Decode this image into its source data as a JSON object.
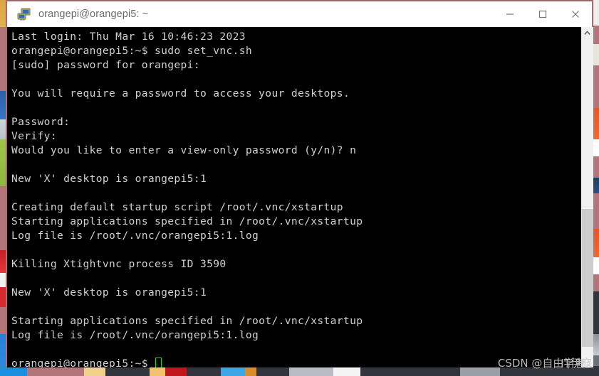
{
  "window": {
    "title": "orangepi@orangepi5: ~",
    "icon": "remote-desktop-icon",
    "controls": [
      {
        "name": "minimize-button",
        "label": "—",
        "glyph": "minimize"
      },
      {
        "name": "maximize-button",
        "label": "☐",
        "glyph": "maximize"
      },
      {
        "name": "close-button",
        "label": "✕",
        "glyph": "close"
      }
    ]
  },
  "terminal": {
    "foreground": "#cfcfcf",
    "background": "#000000",
    "cursor_color": "#21d421",
    "lines": [
      "Last login: Thu Mar 16 10:46:23 2023",
      "orangepi@orangepi5:~$ sudo set_vnc.sh",
      "[sudo] password for orangepi:",
      "",
      "You will require a password to access your desktops.",
      "",
      "Password:",
      "Verify:",
      "Would you like to enter a view-only password (y/n)? n",
      "",
      "New 'X' desktop is orangepi5:1",
      "",
      "Creating default startup script /root/.vnc/xstartup",
      "Starting applications specified in /root/.vnc/xstartup",
      "Log file is /root/.vnc/orangepi5:1.log",
      "",
      "Killing Xtightvnc process ID 3590",
      "",
      "New 'X' desktop is orangepi5:1",
      "",
      "Starting applications specified in /root/.vnc/xstartup",
      "Log file is /root/.vnc/orangepi5:1.log",
      ""
    ],
    "prompt": "orangepi@orangepi5:~$ "
  },
  "scrollbar": {
    "up_arrow": "▲",
    "name": "terminal-scrollbar"
  },
  "watermark": {
    "prefix": "CSDN @自由学者",
    "suffix": "IT伊寇"
  }
}
